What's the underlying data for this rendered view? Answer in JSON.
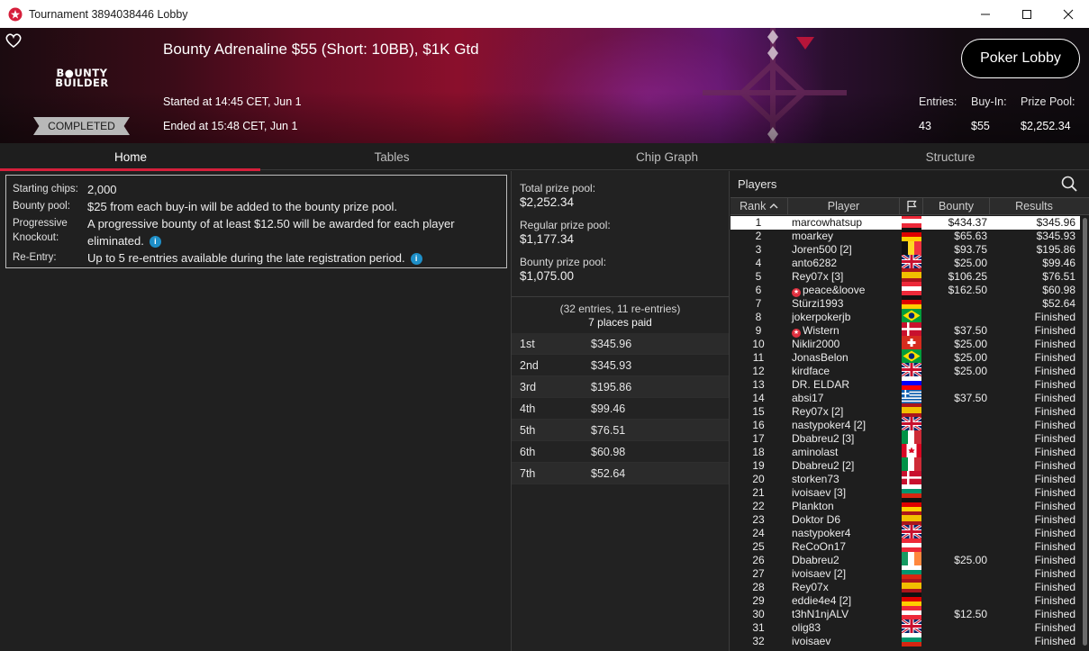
{
  "window": {
    "title": "Tournament 3894038446 Lobby"
  },
  "banner": {
    "brand_line1": "B●UNTY",
    "brand_line2": "BUILDER",
    "status": "COMPLETED",
    "tournament_name": "Bounty Adrenaline $55 (Short: 10BB), $1K Gtd",
    "started": "Started at 14:45 CET, Jun 1",
    "ended": "Ended at 15:48 CET, Jun 1",
    "lobby_button": "Poker Lobby",
    "stats": [
      {
        "label": "Entries:",
        "value": "43"
      },
      {
        "label": "Buy-In:",
        "value": "$55"
      },
      {
        "label": "Prize Pool:",
        "value": "$2,252.34"
      }
    ],
    "accent_color": "#d61f3b"
  },
  "tabs": [
    "Home",
    "Tables",
    "Chip Graph",
    "Structure"
  ],
  "active_tab": "Home",
  "info": {
    "starting_chips_label": "Starting chips:",
    "starting_chips_value": "2,000",
    "bounty_pool_label": "Bounty pool:",
    "bounty_pool_value": "$25 from each buy-in will be added to the bounty prize pool.",
    "knockout_label": "Progressive Knockout:",
    "knockout_value": "A progressive bounty of at least $12.50 will be awarded for each player eliminated.",
    "reentry_label": "Re-Entry:",
    "reentry_value": "Up to 5 re-entries available during the late registration period.",
    "info_icon": "i"
  },
  "prize": {
    "total_label": "Total prize pool:",
    "total_value": "$2,252.34",
    "regular_label": "Regular prize pool:",
    "regular_value": "$1,177.34",
    "bounty_label": "Bounty prize pool:",
    "bounty_value": "$1,075.00",
    "entries_line": "(32 entries, 11 re-entries)",
    "places_line": "7 places paid",
    "payouts": [
      {
        "place": "1st",
        "amount": "$345.96"
      },
      {
        "place": "2nd",
        "amount": "$345.93"
      },
      {
        "place": "3rd",
        "amount": "$195.86"
      },
      {
        "place": "4th",
        "amount": "$99.46"
      },
      {
        "place": "5th",
        "amount": "$76.51"
      },
      {
        "place": "6th",
        "amount": "$60.98"
      },
      {
        "place": "7th",
        "amount": "$52.64"
      }
    ]
  },
  "players": {
    "header": "Players",
    "columns": {
      "rank": "Rank",
      "player": "Player",
      "bounty": "Bounty",
      "results": "Results"
    },
    "flags": {
      "at": {
        "dir": "h",
        "colors": [
          "#ed2939",
          "#ffffff",
          "#ed2939"
        ]
      },
      "de": {
        "dir": "h",
        "colors": [
          "#111111",
          "#dd0000",
          "#ffce00"
        ]
      },
      "be": {
        "dir": "v",
        "colors": [
          "#111111",
          "#fdda24",
          "#ef3340"
        ]
      },
      "uk": {
        "dir": "uk",
        "colors": [
          "#012169",
          "#ffffff",
          "#c8102e"
        ]
      },
      "es": {
        "dir": "hs",
        "colors": [
          "#aa151b",
          "#f1bf00",
          "#aa151b"
        ]
      },
      "br": {
        "dir": "br",
        "colors": [
          "#009c3b",
          "#ffdf00",
          "#002776"
        ]
      },
      "dk": {
        "dir": "dk",
        "colors": [
          "#c8102e",
          "#ffffff"
        ]
      },
      "ch": {
        "dir": "ch",
        "colors": [
          "#d52b1e",
          "#ffffff"
        ]
      },
      "si": {
        "dir": "h",
        "colors": [
          "#ffffff",
          "#0000ff",
          "#ff0000"
        ]
      },
      "gr": {
        "dir": "gr",
        "colors": [
          "#0d5eaf",
          "#ffffff"
        ]
      },
      "it": {
        "dir": "v",
        "colors": [
          "#009246",
          "#ffffff",
          "#ce2b37"
        ]
      },
      "ca": {
        "dir": "ca",
        "colors": [
          "#d80621",
          "#ffffff"
        ]
      },
      "bg": {
        "dir": "h",
        "colors": [
          "#ffffff",
          "#00966e",
          "#d62612"
        ]
      },
      "ie": {
        "dir": "v",
        "colors": [
          "#169b62",
          "#ffffff",
          "#ff883e"
        ]
      }
    },
    "rows": [
      {
        "rank": "1",
        "name": "marcowhatsup",
        "star": false,
        "flag": "at",
        "bounty": "$434.37",
        "result": "$345.96"
      },
      {
        "rank": "2",
        "name": "moarkey",
        "star": false,
        "flag": "de",
        "bounty": "$65.63",
        "result": "$345.93"
      },
      {
        "rank": "3",
        "name": "Joren500 [2]",
        "star": false,
        "flag": "be",
        "bounty": "$93.75",
        "result": "$195.86"
      },
      {
        "rank": "4",
        "name": "anto6282",
        "star": false,
        "flag": "uk",
        "bounty": "$25.00",
        "result": "$99.46"
      },
      {
        "rank": "5",
        "name": "Rey07x [3]",
        "star": false,
        "flag": "es",
        "bounty": "$106.25",
        "result": "$76.51"
      },
      {
        "rank": "6",
        "name": "peace&loove",
        "star": true,
        "flag": "at",
        "bounty": "$162.50",
        "result": "$60.98"
      },
      {
        "rank": "7",
        "name": "Stürzi1993",
        "star": false,
        "flag": "de",
        "bounty": "",
        "result": "$52.64"
      },
      {
        "rank": "8",
        "name": "jokerpokerjb",
        "star": false,
        "flag": "br",
        "bounty": "",
        "result": "Finished"
      },
      {
        "rank": "9",
        "name": "Wistern",
        "star": true,
        "flag": "dk",
        "bounty": "$37.50",
        "result": "Finished"
      },
      {
        "rank": "10",
        "name": "Niklir2000",
        "star": false,
        "flag": "ch",
        "bounty": "$25.00",
        "result": "Finished"
      },
      {
        "rank": "11",
        "name": "JonasBelon",
        "star": false,
        "flag": "br",
        "bounty": "$25.00",
        "result": "Finished"
      },
      {
        "rank": "12",
        "name": "kirdface",
        "star": false,
        "flag": "uk",
        "bounty": "$25.00",
        "result": "Finished"
      },
      {
        "rank": "13",
        "name": "DR. ELDAR",
        "star": false,
        "flag": "si",
        "bounty": "",
        "result": "Finished"
      },
      {
        "rank": "14",
        "name": "absi17",
        "star": false,
        "flag": "gr",
        "bounty": "$37.50",
        "result": "Finished"
      },
      {
        "rank": "15",
        "name": "Rey07x [2]",
        "star": false,
        "flag": "es",
        "bounty": "",
        "result": "Finished"
      },
      {
        "rank": "16",
        "name": "nastypoker4 [2]",
        "star": false,
        "flag": "uk",
        "bounty": "",
        "result": "Finished"
      },
      {
        "rank": "17",
        "name": "Dbabreu2 [3]",
        "star": false,
        "flag": "it",
        "bounty": "",
        "result": "Finished"
      },
      {
        "rank": "18",
        "name": "aminolast",
        "star": false,
        "flag": "ca",
        "bounty": "",
        "result": "Finished"
      },
      {
        "rank": "19",
        "name": "Dbabreu2 [2]",
        "star": false,
        "flag": "it",
        "bounty": "",
        "result": "Finished"
      },
      {
        "rank": "20",
        "name": "storken73",
        "star": false,
        "flag": "dk",
        "bounty": "",
        "result": "Finished"
      },
      {
        "rank": "21",
        "name": "ivoisaev [3]",
        "star": false,
        "flag": "bg",
        "bounty": "",
        "result": "Finished"
      },
      {
        "rank": "22",
        "name": "Plankton",
        "star": false,
        "flag": "de",
        "bounty": "",
        "result": "Finished"
      },
      {
        "rank": "23",
        "name": "Doktor D6",
        "star": false,
        "flag": "es",
        "bounty": "",
        "result": "Finished"
      },
      {
        "rank": "24",
        "name": "nastypoker4",
        "star": false,
        "flag": "uk",
        "bounty": "",
        "result": "Finished"
      },
      {
        "rank": "25",
        "name": "ReCoOn17",
        "star": false,
        "flag": "at",
        "bounty": "",
        "result": "Finished"
      },
      {
        "rank": "26",
        "name": "Dbabreu2",
        "star": false,
        "flag": "ie",
        "bounty": "$25.00",
        "result": "Finished"
      },
      {
        "rank": "27",
        "name": "ivoisaev [2]",
        "star": false,
        "flag": "bg",
        "bounty": "",
        "result": "Finished"
      },
      {
        "rank": "28",
        "name": "Rey07x",
        "star": false,
        "flag": "es",
        "bounty": "",
        "result": "Finished"
      },
      {
        "rank": "29",
        "name": "eddie4e4 [2]",
        "star": false,
        "flag": "de",
        "bounty": "",
        "result": "Finished"
      },
      {
        "rank": "30",
        "name": "t3hN1njALV",
        "star": false,
        "flag": "at",
        "bounty": "$12.50",
        "result": "Finished"
      },
      {
        "rank": "31",
        "name": "olig83",
        "star": false,
        "flag": "uk",
        "bounty": "",
        "result": "Finished"
      },
      {
        "rank": "32",
        "name": "ivoisaev",
        "star": false,
        "flag": "bg",
        "bounty": "",
        "result": "Finished"
      }
    ],
    "selected_rank": "1"
  }
}
